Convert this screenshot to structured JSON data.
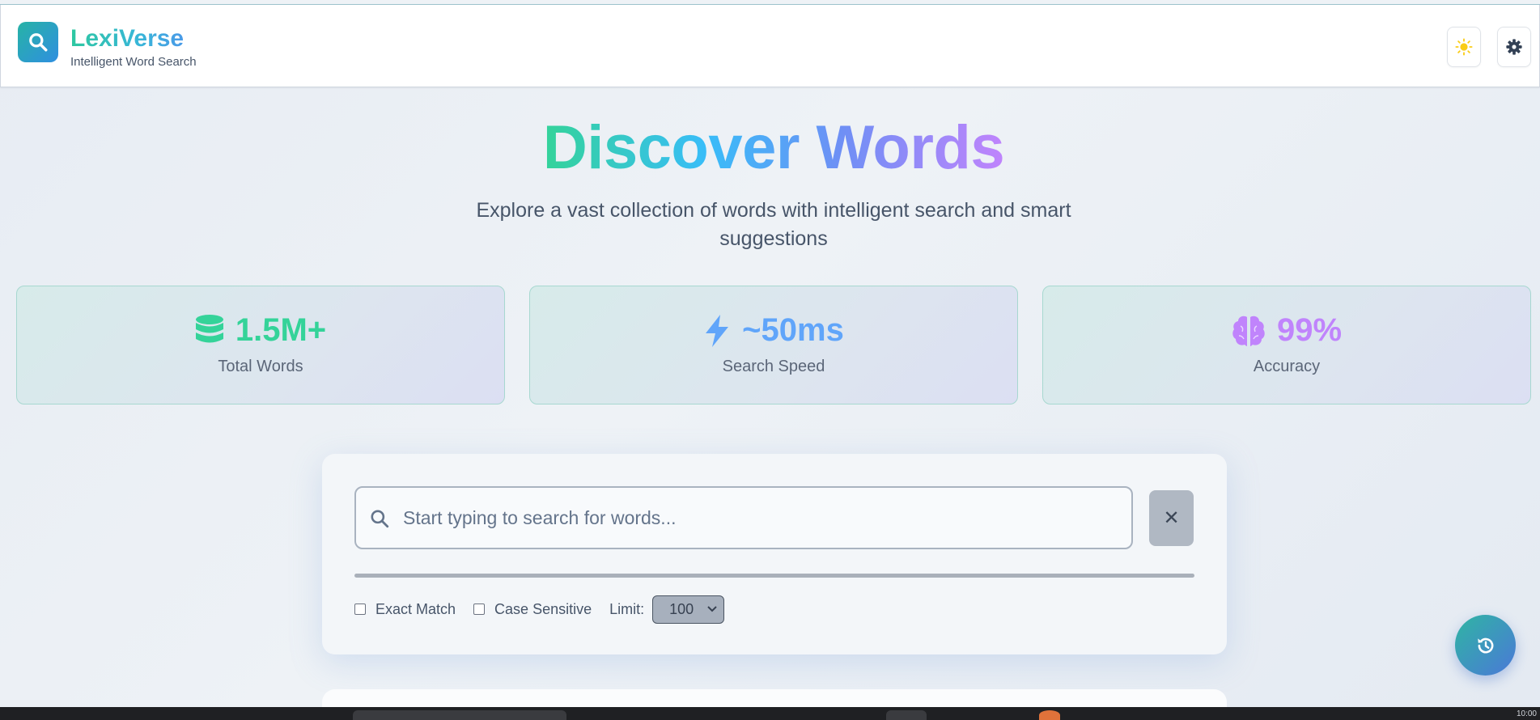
{
  "app": {
    "name": "LexiVerse",
    "tagline": "Intelligent Word Search"
  },
  "header": {
    "theme_icon": "sun-icon",
    "settings_icon": "gear-icon"
  },
  "hero": {
    "title": "Discover Words",
    "subtitle": "Explore a vast collection of words with intelligent search and smart suggestions"
  },
  "stats": [
    {
      "icon": "database-icon",
      "value": "1.5M+",
      "label": "Total Words",
      "color": "#34d399"
    },
    {
      "icon": "bolt-icon",
      "value": "~50ms",
      "label": "Search Speed",
      "color": "#60a5fa"
    },
    {
      "icon": "brain-icon",
      "value": "99%",
      "label": "Accuracy",
      "color": "#c084fc"
    }
  ],
  "search": {
    "placeholder": "Start typing to search for words...",
    "value": "",
    "clear_label": "✕",
    "options": {
      "exact_match": "Exact Match",
      "case_sensitive": "Case Sensitive",
      "limit_label": "Limit:",
      "limit_value": "100"
    }
  },
  "fab": {
    "icon": "history-icon"
  },
  "taskbar": {
    "clock": "10:00"
  }
}
